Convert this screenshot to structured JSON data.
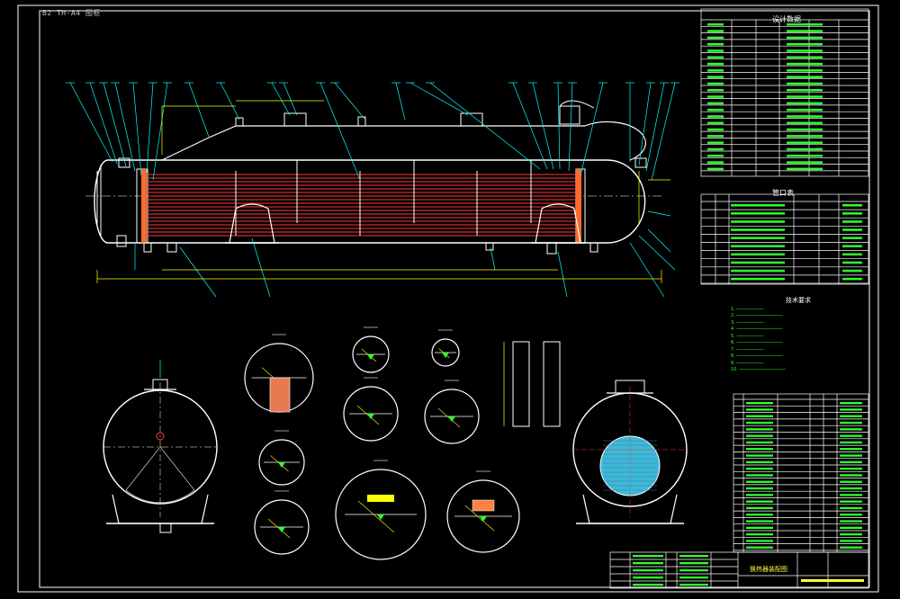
{
  "header": {
    "drawing_tag": "B2 TH-A4 图框"
  },
  "tables": {
    "design_data_title": "设计数据",
    "nozzle_table_title": "管口表"
  },
  "notes": {
    "title": "技术要求",
    "lines": [
      "1.",
      "2.",
      "3.",
      "4.",
      "5.",
      "6.",
      "7.",
      "8.",
      "9.",
      "10."
    ]
  },
  "title_block": {
    "drawing_name": "换热器装配图"
  },
  "colors": {
    "frame": "#ffffff",
    "shell": "#ffffff",
    "tubes": "#ff3a3a",
    "leader": "#00ffff",
    "dimension": "#ffff00",
    "weld": "#ff00ff",
    "notes": "#30ff30",
    "section_fill": "#30ff30",
    "tube_sheet": "#00c0e0"
  }
}
